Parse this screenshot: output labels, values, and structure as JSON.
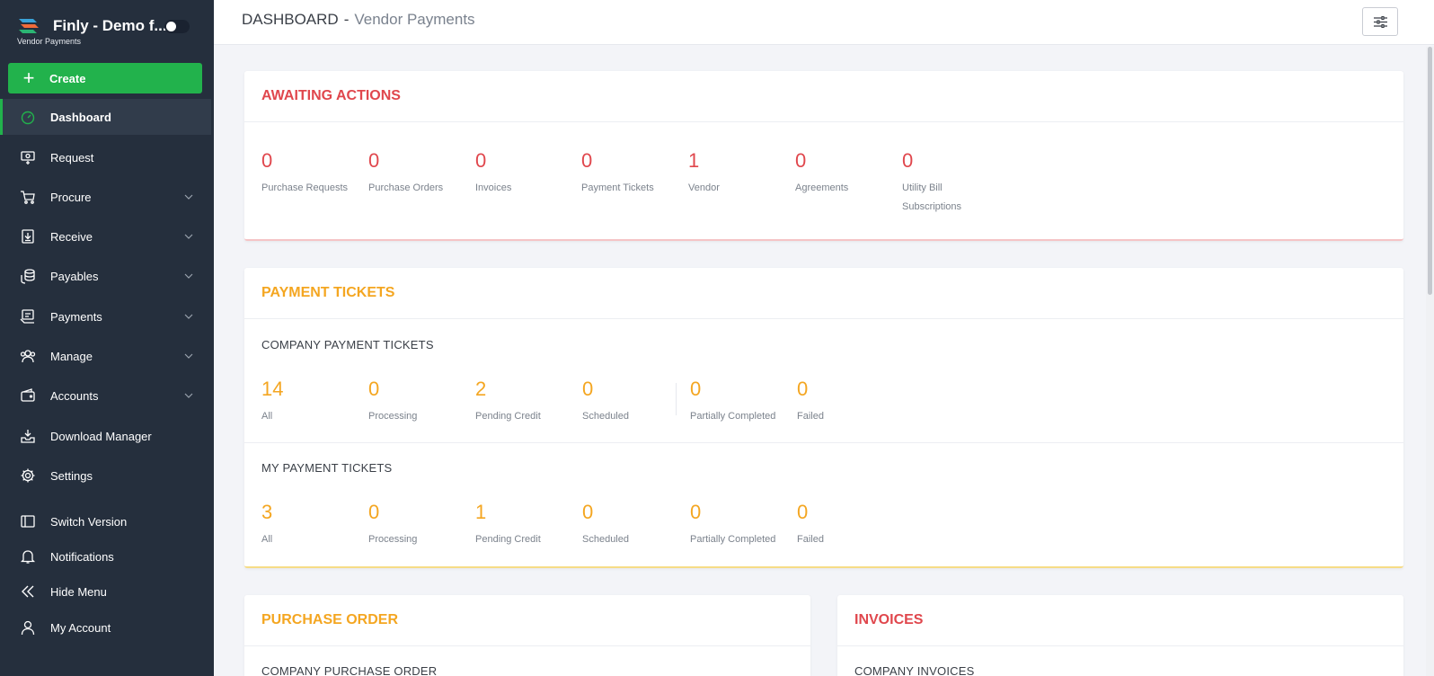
{
  "brand": {
    "title": "Finly - Demo f...",
    "subtitle": "Vendor Payments"
  },
  "create_label": "Create",
  "nav": {
    "dashboard": "Dashboard",
    "request": "Request",
    "procure": "Procure",
    "receive": "Receive",
    "payables": "Payables",
    "payments": "Payments",
    "manage": "Manage",
    "accounts": "Accounts",
    "download_manager": "Download Manager",
    "settings": "Settings",
    "switch_version": "Switch Version",
    "notifications": "Notifications",
    "hide_menu": "Hide Menu",
    "my_account": "My Account"
  },
  "header": {
    "title": "DASHBOARD",
    "separator": "-",
    "breadcrumb": "Vendor Payments"
  },
  "awaiting": {
    "title": "AWAITING ACTIONS",
    "stats": [
      {
        "value": "0",
        "label": "Purchase Requests"
      },
      {
        "value": "0",
        "label": "Purchase Orders"
      },
      {
        "value": "0",
        "label": "Invoices"
      },
      {
        "value": "0",
        "label": "Payment Tickets"
      },
      {
        "value": "1",
        "label": "Vendor"
      },
      {
        "value": "0",
        "label": "Agreements"
      },
      {
        "value": "0",
        "label": "Utility Bill Subscriptions"
      }
    ]
  },
  "payment_tickets": {
    "title": "PAYMENT TICKETS",
    "company": {
      "title": "COMPANY PAYMENT TICKETS",
      "stats": [
        {
          "value": "14",
          "label": "All"
        },
        {
          "value": "0",
          "label": "Processing"
        },
        {
          "value": "2",
          "label": "Pending Credit"
        },
        {
          "value": "0",
          "label": "Scheduled"
        },
        {
          "value": "0",
          "label": "Partially Completed"
        },
        {
          "value": "0",
          "label": "Failed"
        }
      ]
    },
    "mine": {
      "title": "MY PAYMENT TICKETS",
      "stats": [
        {
          "value": "3",
          "label": "All"
        },
        {
          "value": "0",
          "label": "Processing"
        },
        {
          "value": "1",
          "label": "Pending Credit"
        },
        {
          "value": "0",
          "label": "Scheduled"
        },
        {
          "value": "0",
          "label": "Partially Completed"
        },
        {
          "value": "0",
          "label": "Failed"
        }
      ]
    }
  },
  "purchase_order": {
    "title": "PURCHASE ORDER",
    "subtitle": "COMPANY PURCHASE ORDER"
  },
  "invoices": {
    "title": "INVOICES",
    "subtitle": "COMPANY INVOICES"
  },
  "colors": {
    "sidebar": "#252f3d",
    "accent_green": "#22b24c",
    "red": "#e0474d",
    "orange": "#f4a621"
  }
}
